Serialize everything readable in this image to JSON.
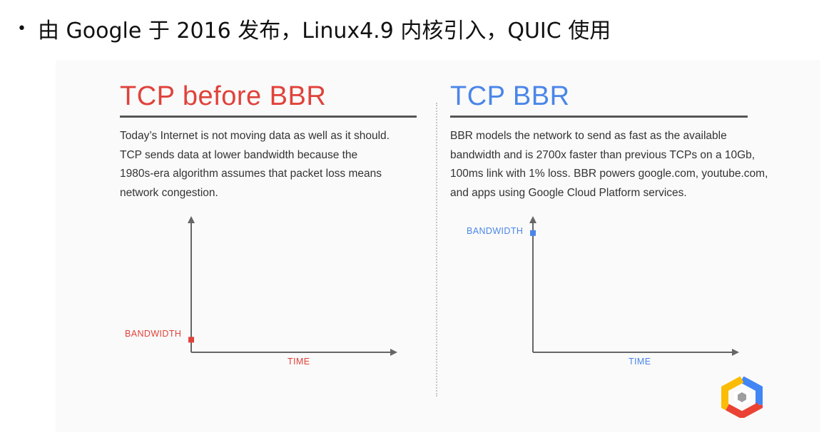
{
  "bullet": {
    "text": "由 Google 于 2016 发布，Linux4.9 内核引入，QUIC 使用"
  },
  "left": {
    "title": "TCP before BBR",
    "title_color": "#e0423a",
    "lines": [
      "Today’s Internet is not moving data as well as it should.",
      "TCP sends data at lower bandwidth because the",
      "1980s-era algorithm assumes that packet loss means",
      "network congestion."
    ],
    "chart": {
      "y_label": "BANDWIDTH",
      "x_label": "TIME",
      "bandwidth_level": 0.1
    }
  },
  "right": {
    "title": "TCP BBR",
    "title_color": "#4a86e8",
    "lines": [
      "BBR models the network to send as fast as the available",
      "bandwidth and is 2700x faster than previous TCPs on a 10Gb,",
      "100ms link with 1% loss. BBR powers google.com, youtube.com,",
      "and apps using Google Cloud Platform services."
    ],
    "chart": {
      "y_label": "BANDWIDTH",
      "x_label": "TIME",
      "bandwidth_level": 0.95
    }
  },
  "logo": {
    "icon": "google-cloud-hexagon-icon"
  }
}
